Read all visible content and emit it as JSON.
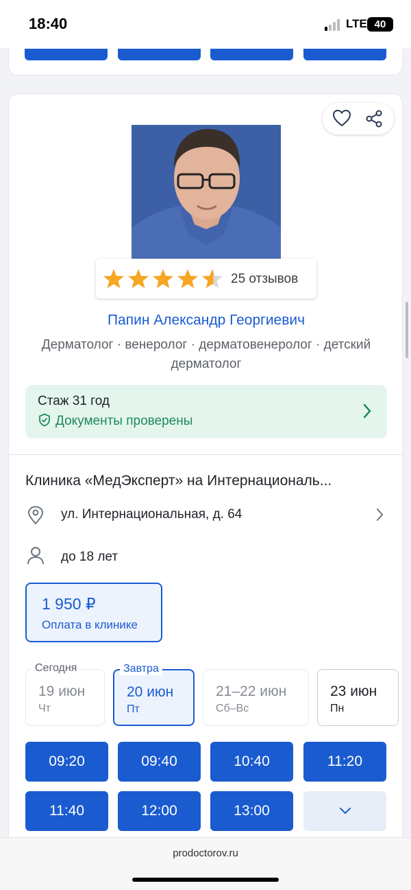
{
  "status_bar": {
    "time": "18:40",
    "network": "LTE",
    "battery": "40"
  },
  "doctor": {
    "name": "Папин Александр Георгиевич",
    "specialties": "Дерматолог · венеролог · дерматовенеролог · детский дерматолог",
    "rating": 4.5,
    "reviews": "25 отзывов",
    "experience": "Стаж 31 год",
    "documents": "Документы проверены"
  },
  "clinic": {
    "name": "Клиника «МедЭксперт» на Интернациональ...",
    "address": "ул. Интернациональная, д. 64",
    "age": "до 18 лет",
    "price": "1 950 ₽",
    "payment": "Оплата в клинике"
  },
  "days": [
    {
      "label": "Сегодня",
      "date": "19 июн",
      "dow": "Чт"
    },
    {
      "label": "Завтра",
      "date": "20 июн",
      "dow": "Пт"
    },
    {
      "label": "",
      "date": "21–22 июн",
      "dow": "Сб–Вс"
    },
    {
      "label": "",
      "date": "23 июн",
      "dow": "Пн"
    }
  ],
  "slots": [
    "09:20",
    "09:40",
    "10:40",
    "11:20",
    "11:40",
    "12:00",
    "13:00"
  ],
  "browser": {
    "url": "prodoctorov.ru"
  },
  "colors": {
    "accent": "#1a5bd0",
    "verified": "#1d8a5b",
    "star": "#f5a623"
  },
  "icons": [
    "heart-icon",
    "share-icon",
    "star-icon",
    "shield-check-icon",
    "chevron-right-icon",
    "location-pin-icon",
    "person-icon",
    "chevron-down-icon"
  ]
}
